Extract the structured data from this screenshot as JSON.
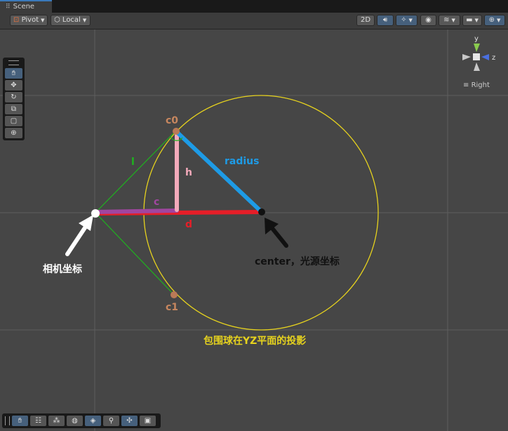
{
  "window": {
    "tab_title": "Scene"
  },
  "toolbar": {
    "pivot_label": "Pivot",
    "local_label": "Local",
    "twod_label": "2D"
  },
  "gizmo": {
    "y_label": "y",
    "z_label": "z",
    "view_label": "Right"
  },
  "tools": [
    "hand-tool",
    "move-tool",
    "rotate-tool",
    "scale-tool",
    "rect-tool",
    "transform-tool"
  ],
  "bottom_tools": [
    "hand",
    "inspector",
    "noise",
    "globe",
    "layers",
    "search",
    "move",
    "camera"
  ],
  "annotations": {
    "c0": "c0",
    "c1": "c1",
    "l": "l",
    "h": "h",
    "radius": "radius",
    "c": "c",
    "d": "d",
    "camera_label": "相机坐标",
    "center_label": "center，光源坐标",
    "projection_label": "包围球在YZ平面的投影"
  },
  "colors": {
    "scene_bg": "#464646",
    "grid": "#5e5e5e",
    "circle": "#e6d21e",
    "radius_line": "#1e9be6",
    "h_line": "#f4aabb",
    "c_line": "#a046a0",
    "d_line": "#e61e28",
    "l_lines": "#1eb41e",
    "point_fill": "#b97a57",
    "accent": "#46607c"
  }
}
